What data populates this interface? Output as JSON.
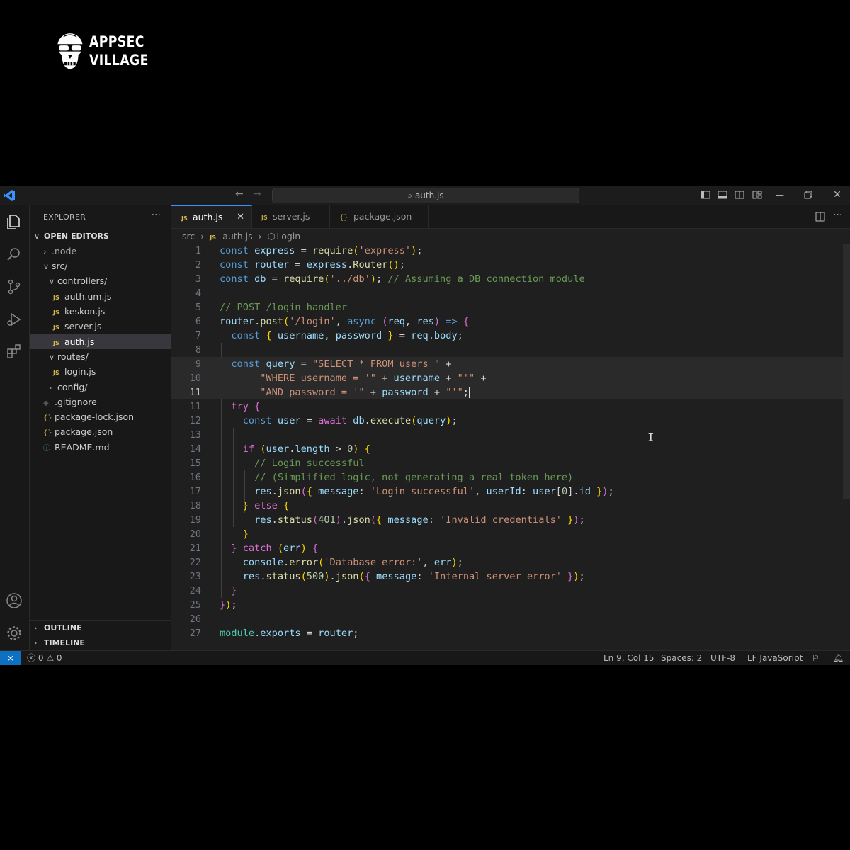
{
  "logo": {
    "line1": "APPSEC",
    "line2": "VILLAGE"
  },
  "titlebar": {
    "search_text": "auth.js",
    "back": "←",
    "forward": "→"
  },
  "sidebar": {
    "header": "EXPLORER",
    "more": "···",
    "open_editors": "OPEN EDITORS",
    "tree": [
      {
        "label": ".node"
      },
      {
        "label": "src/"
      },
      {
        "label": "controllers/"
      },
      {
        "label": "auth.um.js"
      },
      {
        "label": "keskon.js"
      },
      {
        "label": "server.js"
      },
      {
        "label": "auth.js"
      },
      {
        "label": "routes/"
      },
      {
        "label": "login.js"
      },
      {
        "label": "config/"
      },
      {
        "label": ".gitignore"
      },
      {
        "label": "package-lock.json"
      },
      {
        "label": "package.json"
      },
      {
        "label": "README.md"
      }
    ],
    "outline": "OUTLINE",
    "timeline": "TIMELINE"
  },
  "tabs": [
    {
      "label": "auth.js",
      "badge": "JS"
    },
    {
      "label": "server.js",
      "badge": "JS"
    },
    {
      "label": "package.json",
      "badge": "{}"
    }
  ],
  "breadcrumb": {
    "folder": "src",
    "file": "auth.js",
    "symbol": "Login"
  },
  "code": {
    "line_numbers": [
      "1",
      "2",
      "3",
      "4",
      "5",
      "6",
      "7",
      "8",
      "9",
      "10",
      "11",
      "11",
      "12",
      "13",
      "14",
      "15",
      "16",
      "17",
      "18",
      "19",
      "20",
      "21",
      "22",
      "23",
      "24",
      "25",
      "26",
      "27"
    ]
  },
  "statusbar": {
    "errors": "0",
    "warnings": "0",
    "position": "Ln 9, Col 15",
    "spaces": "Spaces: 2",
    "encoding": "UTF-8",
    "lang": "LF JavaSoript"
  }
}
